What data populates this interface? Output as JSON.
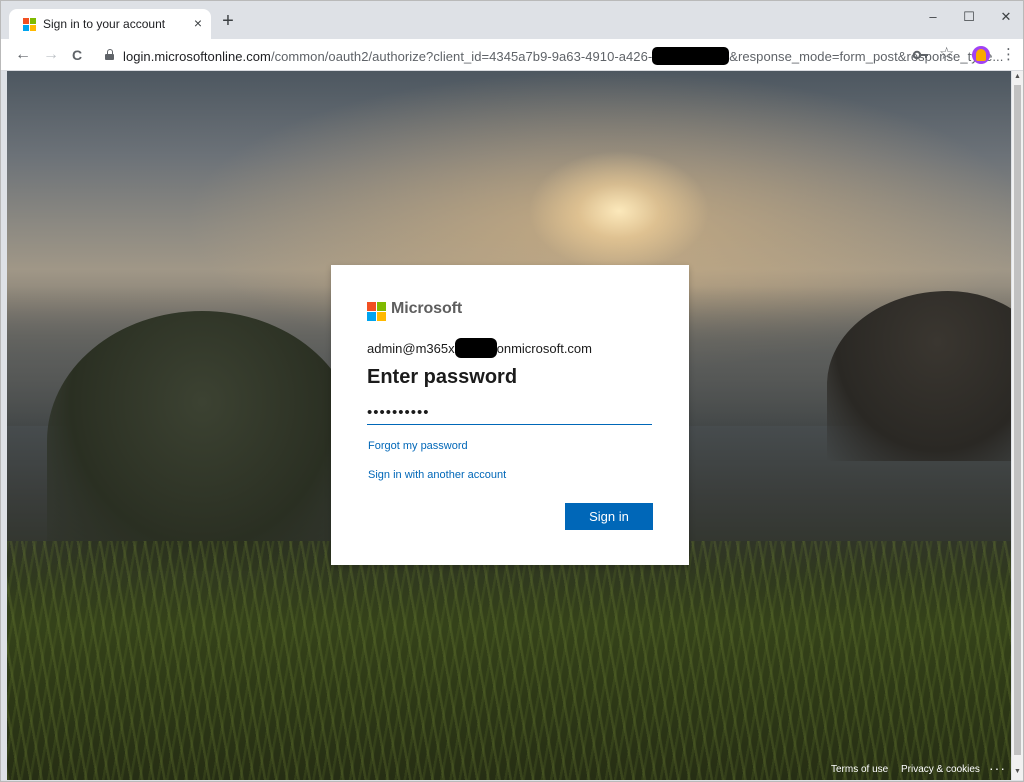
{
  "browser": {
    "tab": {
      "title": "Sign in to your account",
      "close": "×"
    },
    "new_tab": "+",
    "window_controls": {
      "minimize": "–",
      "maximize": "☐",
      "close": "✕"
    },
    "nav": {
      "back": "←",
      "forward": "→",
      "reload": "C"
    },
    "url": {
      "host": "login.microsoftonline.com",
      "path_before": "/common/oauth2/authorize?client_id=4345a7b9-9a63-4910-a426-",
      "path_after": "&response_mode=form_post&response_type..."
    },
    "icons": {
      "lock": "lock-icon",
      "key": "key-icon",
      "star": "star-icon",
      "profile": "profile-avatar",
      "menu": "more-vert-icon"
    },
    "star": "☆",
    "menu": "⋮"
  },
  "signin": {
    "brand": "Microsoft",
    "identity_prefix": "admin@m365x",
    "identity_suffix": "onmicrosoft.com",
    "heading": "Enter password",
    "password_value": "••••••••••",
    "forgot_link": "Forgot my password",
    "other_account_link": "Sign in with another account",
    "submit": "Sign in"
  },
  "footer": {
    "terms": "Terms of use",
    "privacy": "Privacy & cookies",
    "more": "···"
  },
  "colors": {
    "accent": "#0067b8",
    "ms_red": "#f25022",
    "ms_green": "#7fba00",
    "ms_blue": "#00a4ef",
    "ms_yellow": "#ffb900"
  }
}
